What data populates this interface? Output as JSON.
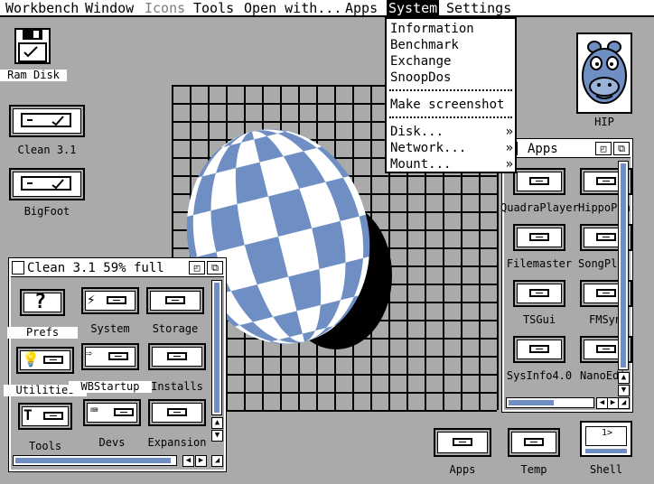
{
  "menubar": {
    "items": [
      {
        "label": "Workbench",
        "state": "normal"
      },
      {
        "label": "Window",
        "state": "normal"
      },
      {
        "label": "Icons",
        "state": "disabled"
      },
      {
        "label": "Tools",
        "state": "normal"
      },
      {
        "label": "Open with...",
        "state": "normal"
      },
      {
        "label": "Apps",
        "state": "normal"
      },
      {
        "label": "System",
        "state": "active"
      },
      {
        "label": "Settings",
        "state": "normal"
      }
    ]
  },
  "system_menu": {
    "group1": [
      "Information",
      "Benchmark",
      "Exchange",
      "SnoopDos"
    ],
    "group2": [
      "Make screenshot"
    ],
    "group3": [
      {
        "label": "Disk...",
        "submark": "»"
      },
      {
        "label": "Network...",
        "submark": "»"
      },
      {
        "label": "Mount...",
        "submark": "»"
      }
    ]
  },
  "desktop": {
    "ram_disk": "Ram Disk",
    "clean31": "Clean 3.1",
    "bigfoot": "BigFoot",
    "hip": "HIP",
    "apps": "Apps",
    "temp": "Temp",
    "shell": "Shell",
    "shell_prompt": "1>"
  },
  "clean_window": {
    "title": "Clean 3.1   59% full",
    "icons": [
      "Prefs",
      "System",
      "Storage",
      "Utilities",
      "WBStartup",
      "Installs",
      "Tools",
      "Devs",
      "Expansion"
    ]
  },
  "apps_window": {
    "title": "Apps",
    "icons": [
      "QuadraPlayer",
      "HippoPla",
      "Filemaster",
      "SongPla",
      "TSGui",
      "FMSyn",
      "SysInfo4.0",
      "NanoEdi"
    ]
  },
  "colors": {
    "desktop_gray": "#aaaaaa",
    "ball_blue": "#6f8fc4",
    "white": "#ffffff",
    "black": "#000000"
  }
}
